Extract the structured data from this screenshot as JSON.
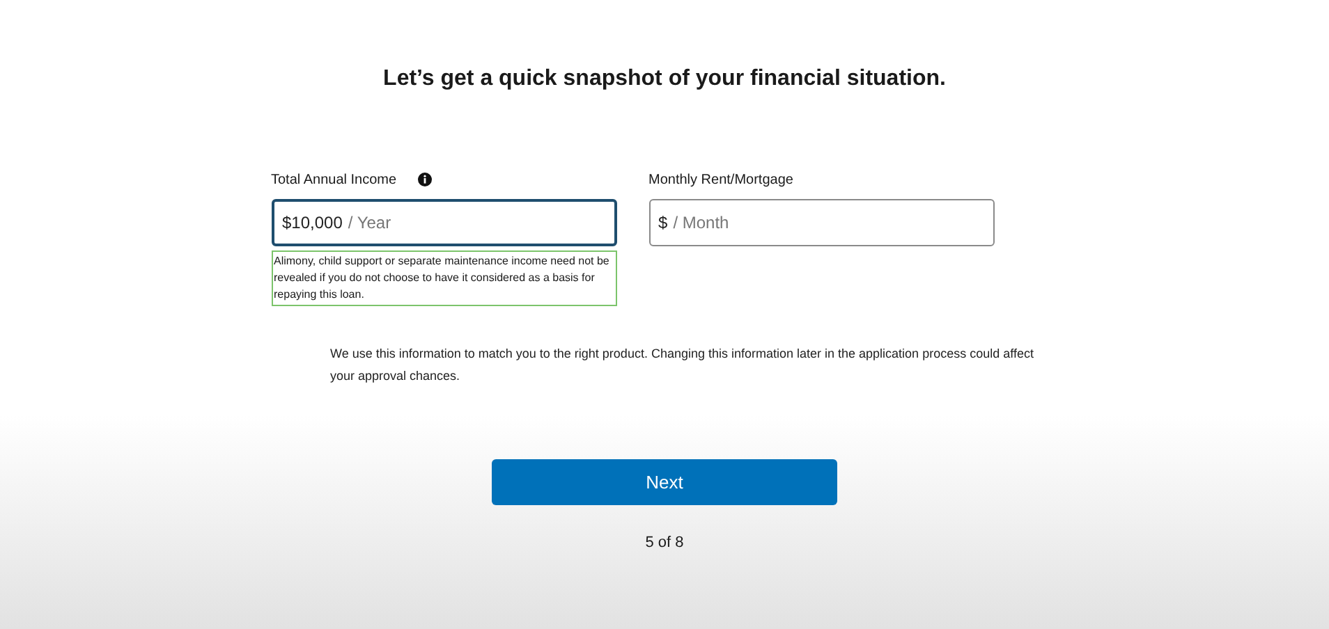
{
  "heading": "Let’s get a quick snapshot of your financial situation.",
  "fields": [
    {
      "label": "Total Annual Income",
      "info_icon": true,
      "value": "$10,000",
      "unit": "/ Year",
      "focused": true,
      "hint": "Alimony, child support or separate maintenance income need not be revealed if you do not choose to have it considered as a basis for repaying this loan."
    },
    {
      "label": "Monthly Rent/Mortgage",
      "info_icon": false,
      "value": "$",
      "unit": "/ Month",
      "focused": false
    }
  ],
  "note": "We use this information to match you to the right product. Changing this information later in the application process could affect your approval chances.",
  "next_button": "Next",
  "progress": "5 of 8"
}
